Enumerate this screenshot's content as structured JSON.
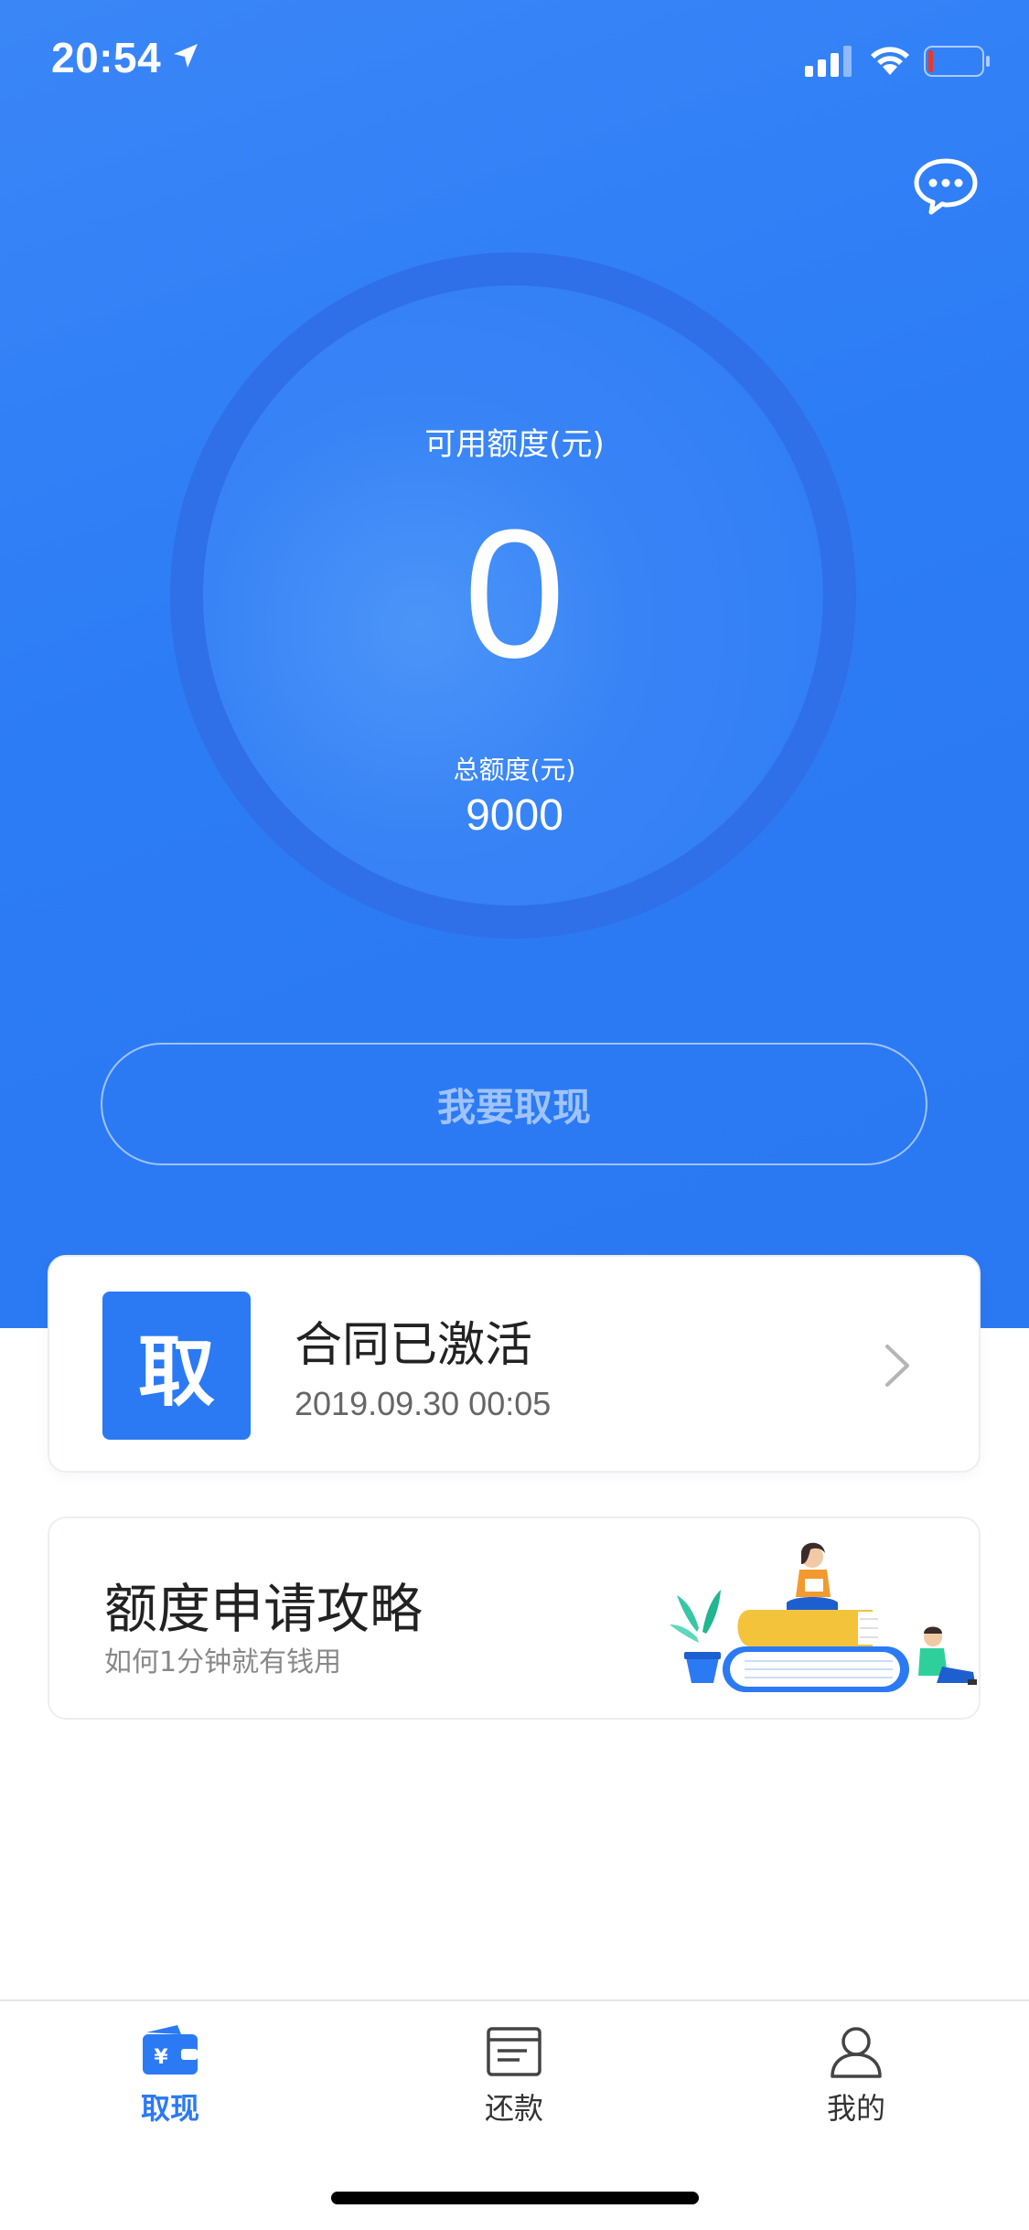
{
  "status_bar": {
    "time": "20:54"
  },
  "credit": {
    "available_label": "可用额度(元)",
    "available_value": "0",
    "total_label": "总额度(元)",
    "total_value": "9000"
  },
  "withdraw_button": {
    "label": "我要取现"
  },
  "contract_card": {
    "badge": "取",
    "title": "合同已激活",
    "date": "2019.09.30 00:05"
  },
  "guide_card": {
    "title": "额度申请攻略",
    "subtitle": "如何1分钟就有钱用"
  },
  "tabbar": {
    "items": [
      {
        "label": "取现",
        "icon": "wallet-yen-icon",
        "active": true
      },
      {
        "label": "还款",
        "icon": "bill-icon",
        "active": false
      },
      {
        "label": "我的",
        "icon": "user-icon",
        "active": false
      }
    ]
  },
  "colors": {
    "primary": "#2b7af3",
    "hero_bg": "#2c7cf6"
  }
}
